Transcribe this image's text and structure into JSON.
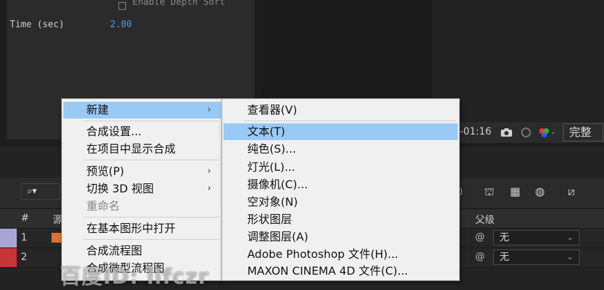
{
  "effect_panel": {
    "checkbox_label": "Enable Depth Sort",
    "time_label": "Time (sec)",
    "time_value": "2.00"
  },
  "viewer_toolbar": {
    "timecode": "-01:16",
    "quality": "完整"
  },
  "timeline": {
    "columns": {
      "number": "#",
      "source": "源",
      "parent": "父级"
    },
    "rows": [
      {
        "number": "1",
        "color": "#a9a6d6",
        "parent": "无"
      },
      {
        "number": "2",
        "color": "#c8343a",
        "parent": "无"
      }
    ]
  },
  "context_menu": {
    "items": [
      {
        "label": "新建",
        "submenu": true,
        "highlighted": true
      },
      {
        "label": "合成设置..."
      },
      {
        "label": "在项目中显示合成"
      },
      {
        "label": "预览(P)",
        "submenu": true
      },
      {
        "label": "切换 3D 视图",
        "submenu": true
      },
      {
        "label": "重命名",
        "disabled": true
      },
      {
        "label": "在基本图形中打开"
      },
      {
        "label": "合成流程图"
      },
      {
        "label": "合成微型流程图"
      }
    ]
  },
  "submenu": {
    "items": [
      {
        "label": "查看器(V)"
      },
      {
        "label": "文本(T)",
        "highlighted": true
      },
      {
        "label": "纯色(S)..."
      },
      {
        "label": "灯光(L)..."
      },
      {
        "label": "摄像机(C)..."
      },
      {
        "label": "空对象(N)"
      },
      {
        "label": "形状图层"
      },
      {
        "label": "调整图层(A)"
      },
      {
        "label": "Adobe Photoshop 文件(H)..."
      },
      {
        "label": "MAXON CINEMA 4D 文件(C)..."
      }
    ]
  },
  "watermark": "百度ID: llfczr",
  "colors": {
    "menu_highlight": "#99c9f5",
    "menu_bg": "#f0f0f0",
    "value_blue": "#4a9fe0"
  }
}
